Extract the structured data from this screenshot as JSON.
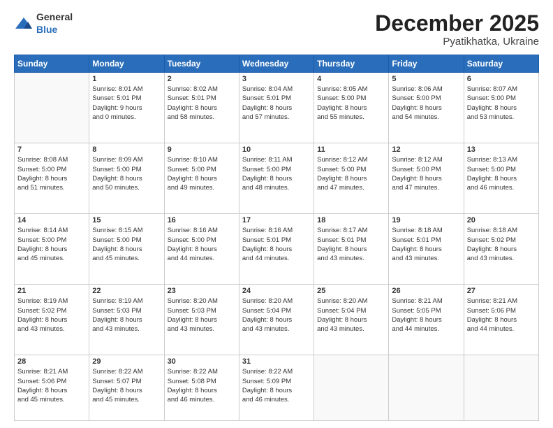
{
  "logo": {
    "general": "General",
    "blue": "Blue"
  },
  "header": {
    "month": "December 2025",
    "location": "Pyatikhatka, Ukraine"
  },
  "weekdays": [
    "Sunday",
    "Monday",
    "Tuesday",
    "Wednesday",
    "Thursday",
    "Friday",
    "Saturday"
  ],
  "weeks": [
    [
      {
        "day": "",
        "content": ""
      },
      {
        "day": "1",
        "content": "Sunrise: 8:01 AM\nSunset: 5:01 PM\nDaylight: 9 hours\nand 0 minutes."
      },
      {
        "day": "2",
        "content": "Sunrise: 8:02 AM\nSunset: 5:01 PM\nDaylight: 8 hours\nand 58 minutes."
      },
      {
        "day": "3",
        "content": "Sunrise: 8:04 AM\nSunset: 5:01 PM\nDaylight: 8 hours\nand 57 minutes."
      },
      {
        "day": "4",
        "content": "Sunrise: 8:05 AM\nSunset: 5:00 PM\nDaylight: 8 hours\nand 55 minutes."
      },
      {
        "day": "5",
        "content": "Sunrise: 8:06 AM\nSunset: 5:00 PM\nDaylight: 8 hours\nand 54 minutes."
      },
      {
        "day": "6",
        "content": "Sunrise: 8:07 AM\nSunset: 5:00 PM\nDaylight: 8 hours\nand 53 minutes."
      }
    ],
    [
      {
        "day": "7",
        "content": "Sunrise: 8:08 AM\nSunset: 5:00 PM\nDaylight: 8 hours\nand 51 minutes."
      },
      {
        "day": "8",
        "content": "Sunrise: 8:09 AM\nSunset: 5:00 PM\nDaylight: 8 hours\nand 50 minutes."
      },
      {
        "day": "9",
        "content": "Sunrise: 8:10 AM\nSunset: 5:00 PM\nDaylight: 8 hours\nand 49 minutes."
      },
      {
        "day": "10",
        "content": "Sunrise: 8:11 AM\nSunset: 5:00 PM\nDaylight: 8 hours\nand 48 minutes."
      },
      {
        "day": "11",
        "content": "Sunrise: 8:12 AM\nSunset: 5:00 PM\nDaylight: 8 hours\nand 47 minutes."
      },
      {
        "day": "12",
        "content": "Sunrise: 8:12 AM\nSunset: 5:00 PM\nDaylight: 8 hours\nand 47 minutes."
      },
      {
        "day": "13",
        "content": "Sunrise: 8:13 AM\nSunset: 5:00 PM\nDaylight: 8 hours\nand 46 minutes."
      }
    ],
    [
      {
        "day": "14",
        "content": "Sunrise: 8:14 AM\nSunset: 5:00 PM\nDaylight: 8 hours\nand 45 minutes."
      },
      {
        "day": "15",
        "content": "Sunrise: 8:15 AM\nSunset: 5:00 PM\nDaylight: 8 hours\nand 45 minutes."
      },
      {
        "day": "16",
        "content": "Sunrise: 8:16 AM\nSunset: 5:00 PM\nDaylight: 8 hours\nand 44 minutes."
      },
      {
        "day": "17",
        "content": "Sunrise: 8:16 AM\nSunset: 5:01 PM\nDaylight: 8 hours\nand 44 minutes."
      },
      {
        "day": "18",
        "content": "Sunrise: 8:17 AM\nSunset: 5:01 PM\nDaylight: 8 hours\nand 43 minutes."
      },
      {
        "day": "19",
        "content": "Sunrise: 8:18 AM\nSunset: 5:01 PM\nDaylight: 8 hours\nand 43 minutes."
      },
      {
        "day": "20",
        "content": "Sunrise: 8:18 AM\nSunset: 5:02 PM\nDaylight: 8 hours\nand 43 minutes."
      }
    ],
    [
      {
        "day": "21",
        "content": "Sunrise: 8:19 AM\nSunset: 5:02 PM\nDaylight: 8 hours\nand 43 minutes."
      },
      {
        "day": "22",
        "content": "Sunrise: 8:19 AM\nSunset: 5:03 PM\nDaylight: 8 hours\nand 43 minutes."
      },
      {
        "day": "23",
        "content": "Sunrise: 8:20 AM\nSunset: 5:03 PM\nDaylight: 8 hours\nand 43 minutes."
      },
      {
        "day": "24",
        "content": "Sunrise: 8:20 AM\nSunset: 5:04 PM\nDaylight: 8 hours\nand 43 minutes."
      },
      {
        "day": "25",
        "content": "Sunrise: 8:20 AM\nSunset: 5:04 PM\nDaylight: 8 hours\nand 43 minutes."
      },
      {
        "day": "26",
        "content": "Sunrise: 8:21 AM\nSunset: 5:05 PM\nDaylight: 8 hours\nand 44 minutes."
      },
      {
        "day": "27",
        "content": "Sunrise: 8:21 AM\nSunset: 5:06 PM\nDaylight: 8 hours\nand 44 minutes."
      }
    ],
    [
      {
        "day": "28",
        "content": "Sunrise: 8:21 AM\nSunset: 5:06 PM\nDaylight: 8 hours\nand 45 minutes."
      },
      {
        "day": "29",
        "content": "Sunrise: 8:22 AM\nSunset: 5:07 PM\nDaylight: 8 hours\nand 45 minutes."
      },
      {
        "day": "30",
        "content": "Sunrise: 8:22 AM\nSunset: 5:08 PM\nDaylight: 8 hours\nand 46 minutes."
      },
      {
        "day": "31",
        "content": "Sunrise: 8:22 AM\nSunset: 5:09 PM\nDaylight: 8 hours\nand 46 minutes."
      },
      {
        "day": "",
        "content": ""
      },
      {
        "day": "",
        "content": ""
      },
      {
        "day": "",
        "content": ""
      }
    ]
  ]
}
